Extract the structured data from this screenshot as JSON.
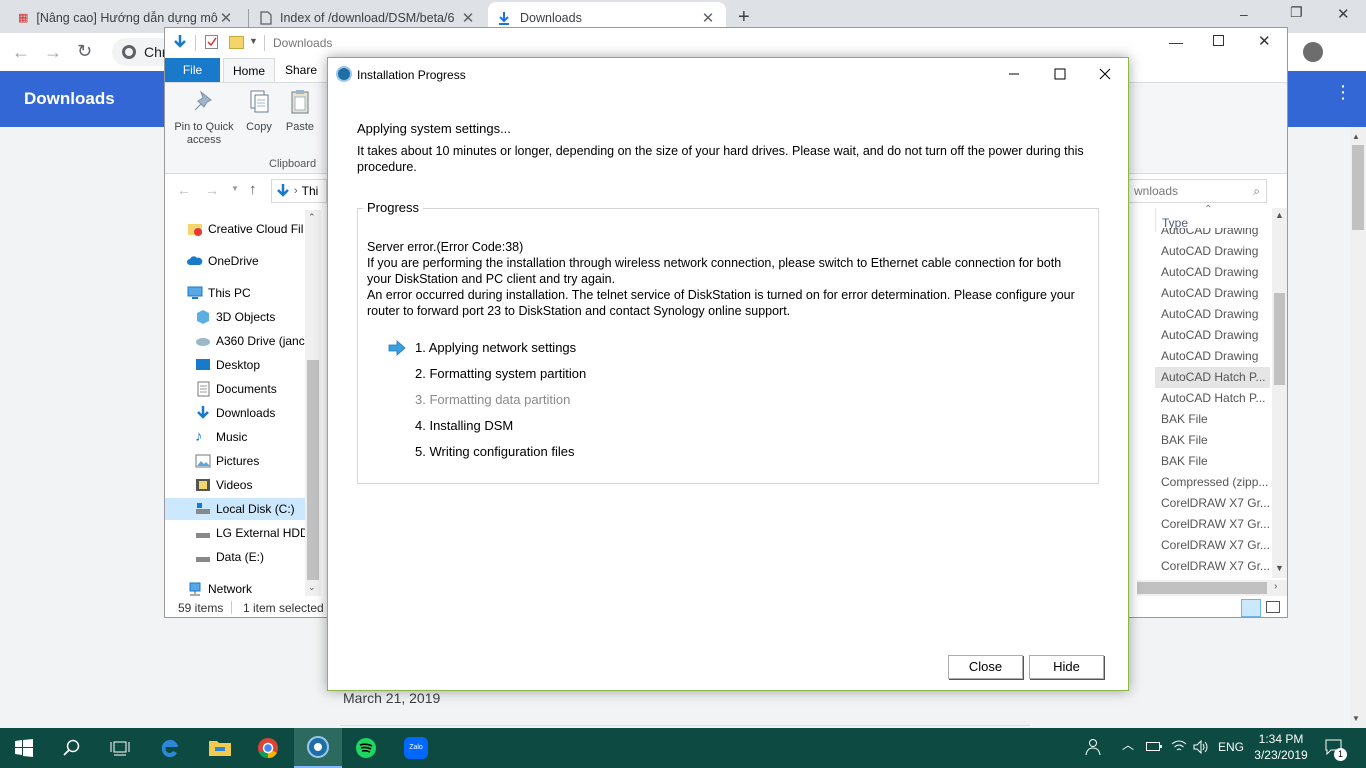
{
  "browser": {
    "tabs": [
      {
        "title": "[Nâng cao] Hướng dẫn dựng mô"
      },
      {
        "title": "Index of /download/DSM/beta/6"
      },
      {
        "title": "Downloads"
      }
    ],
    "omnibox_text": "Chr",
    "page_title": "Downloads",
    "date_label": "March 21, 2019"
  },
  "explorer": {
    "title": "Downloads",
    "ribbon_tabs": {
      "file": "File",
      "home": "Home",
      "share": "Share"
    },
    "ribbon": {
      "pin_label": "Pin to Quick access",
      "copy_label": "Copy",
      "paste_label": "Paste",
      "clipboard_group": "Clipboard"
    },
    "breadcrumb_text": "Thi",
    "search_placeholder": "wnloads",
    "nav_items": [
      {
        "label": "Creative Cloud Fil"
      },
      {
        "label": "OneDrive"
      },
      {
        "label": "This PC"
      },
      {
        "label": "3D Objects"
      },
      {
        "label": "A360 Drive (janc"
      },
      {
        "label": "Desktop"
      },
      {
        "label": "Documents"
      },
      {
        "label": "Downloads"
      },
      {
        "label": "Music"
      },
      {
        "label": "Pictures"
      },
      {
        "label": "Videos"
      },
      {
        "label": "Local Disk (C:)"
      },
      {
        "label": "LG External HDD"
      },
      {
        "label": "Data (E:)"
      },
      {
        "label": "Network"
      }
    ],
    "type_header": "Type",
    "type_cells": [
      "AutoCAD Drawing",
      "AutoCAD Drawing",
      "AutoCAD Drawing",
      "AutoCAD Drawing",
      "AutoCAD Drawing",
      "AutoCAD Drawing",
      "AutoCAD Drawing",
      "AutoCAD Hatch P...",
      "AutoCAD Hatch P...",
      "BAK File",
      "BAK File",
      "BAK File",
      "Compressed (zipp...",
      "CorelDRAW X7 Gr...",
      "CorelDRAW X7 Gr...",
      "CorelDRAW X7 Gr...",
      "CorelDRAW X7 Gr..."
    ],
    "status": {
      "items": "59 items",
      "selected": "1 item selected"
    }
  },
  "dialog": {
    "title": "Installation Progress",
    "heading": "Applying system settings...",
    "description": "It takes about 10 minutes or longer, depending on the size of your hard drives. Please wait, and do not turn off the power during this procedure.",
    "group_label": "Progress",
    "error_lines": [
      "Server error.(Error Code:38)",
      "If you are performing the installation through wireless network connection, please switch to Ethernet cable connection for both your DiskStation and PC client and try again.",
      "An error occurred during installation. The telnet service of DiskStation is turned on for error determination. Please configure your router to forward port 23 to DiskStation and contact Synology online support."
    ],
    "steps": [
      {
        "label": "1. Applying network settings"
      },
      {
        "label": "2. Formatting system partition"
      },
      {
        "label": "3. Formatting data partition"
      },
      {
        "label": "4. Installing DSM"
      },
      {
        "label": "5. Writing configuration files"
      }
    ],
    "current_step": 1,
    "buttons": {
      "close": "Close",
      "hide": "Hide"
    },
    "accent_color": "#8ab84a"
  },
  "taskbar": {
    "language": "ENG",
    "time": "1:34 PM",
    "date": "3/23/2019",
    "notification_count": "1",
    "color": "#0c4a42"
  }
}
